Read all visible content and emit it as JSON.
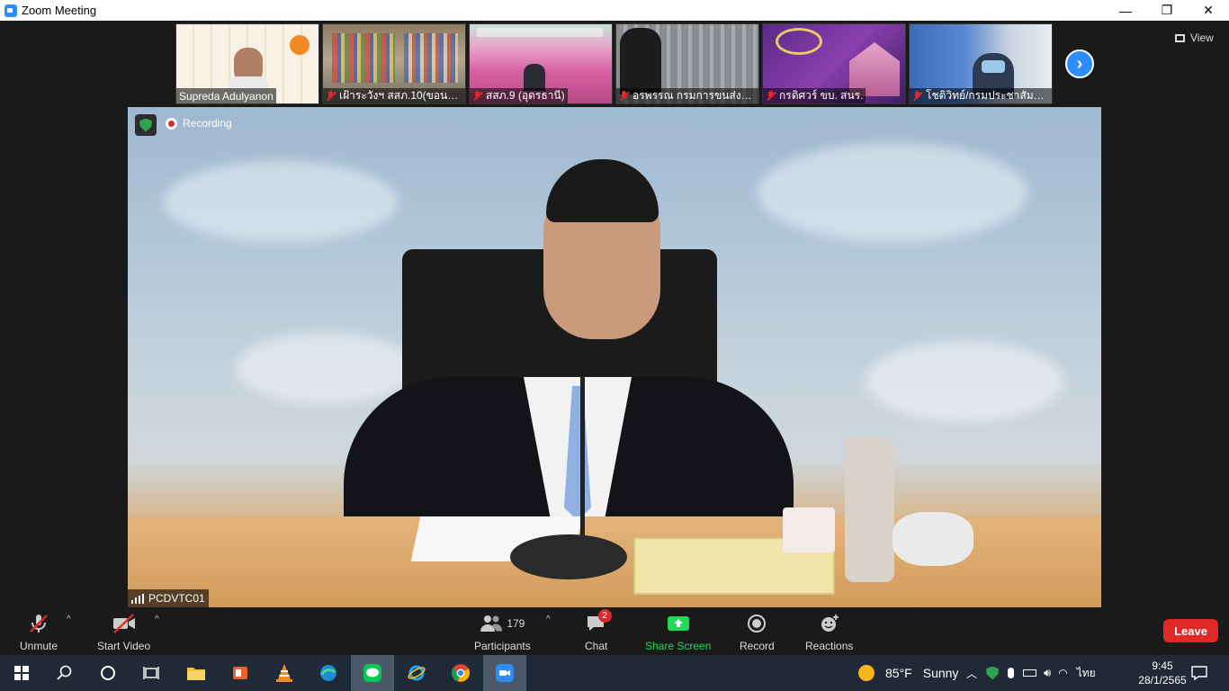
{
  "window": {
    "title": "Zoom Meeting",
    "minimize": "—",
    "restore": "❐",
    "close": "✕"
  },
  "gallery": {
    "participants": [
      {
        "name": "Supreda Adulyanon"
      },
      {
        "name": "เฝ้าระวังฯ สสภ.10(ขอนแ..."
      },
      {
        "name": "สสภ.9 (อุดรธานี)"
      },
      {
        "name": "อรพรรณ กรมการขนส่งท..."
      },
      {
        "name": "กรดิศวร์ ขบ. สนร."
      },
      {
        "name": "โชติวิทย์/กรมประชาสัมพันธ์"
      }
    ],
    "view_label": "View"
  },
  "main_video": {
    "recording_label": "Recording",
    "participant_name": "PCDVTC01"
  },
  "toolbar": {
    "unmute_label": "Unmute",
    "start_video_label": "Start Video",
    "participants_label": "Participants",
    "participants_count": "179",
    "chat_label": "Chat",
    "chat_badge": "2",
    "share_screen_label": "Share Screen",
    "record_label": "Record",
    "reactions_label": "Reactions",
    "leave_label": "Leave"
  },
  "taskbar": {
    "weather_temp": "85°F",
    "weather_text": "Sunny",
    "language": "ไทย",
    "time": "9:45",
    "date": "28/1/2565"
  },
  "colors": {
    "accent": "#2d8cff",
    "leave": "#e02828",
    "share": "#23d959",
    "muted": "#e02828"
  }
}
